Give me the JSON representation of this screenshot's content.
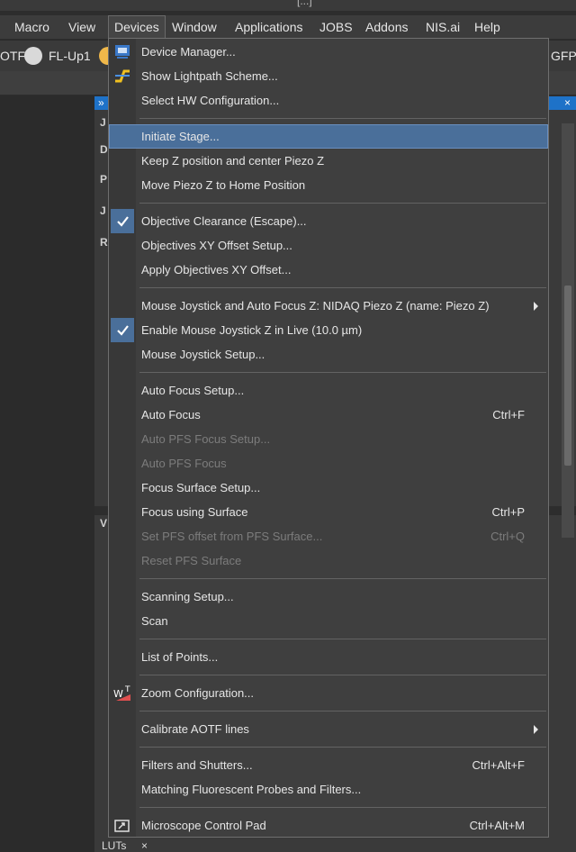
{
  "titlebar": {
    "fragment": "[...]"
  },
  "menubar": [
    {
      "label": "Macro",
      "active": false
    },
    {
      "label": "View",
      "active": false
    },
    {
      "label": "Devices",
      "active": true
    },
    {
      "label": "Window",
      "active": false
    },
    {
      "label": "Applications",
      "active": false
    },
    {
      "label": "JOBS",
      "active": false
    },
    {
      "label": "Addons",
      "active": false
    },
    {
      "label": "NIS.ai",
      "active": false
    },
    {
      "label": "Help",
      "active": false
    }
  ],
  "toolbar": {
    "left_label": "OTF",
    "fl_label": "FL-Up1",
    "right_label": "GFP"
  },
  "dock": {
    "header_arrows": "»",
    "close": "×",
    "letters": [
      "J",
      "D",
      "P",
      "J",
      "R",
      "V"
    ]
  },
  "bottom_tab": {
    "label": "LUTs",
    "close": "×"
  },
  "menu": {
    "groups": [
      [
        {
          "label": "Device Manager...",
          "icon": "device-manager-icon"
        },
        {
          "label": "Show Lightpath Scheme...",
          "icon": "lightpath-icon"
        },
        {
          "label": "Select HW Configuration..."
        }
      ],
      [
        {
          "label": "Initiate Stage...",
          "highlighted": true
        },
        {
          "label": "Keep Z position and center Piezo Z"
        },
        {
          "label": "Move Piezo Z to Home Position"
        }
      ],
      [
        {
          "label": "Objective Clearance (Escape)...",
          "checked": true
        },
        {
          "label": "Objectives XY Offset Setup..."
        },
        {
          "label": "Apply Objectives XY Offset..."
        }
      ],
      [
        {
          "label": "Mouse Joystick and Auto Focus Z: NIDAQ Piezo Z (name: Piezo Z)",
          "submenu": true
        },
        {
          "label": "Enable Mouse Joystick Z in Live (10.0 µm)",
          "checked": true
        },
        {
          "label": "Mouse Joystick Setup..."
        }
      ],
      [
        {
          "label": "Auto Focus Setup..."
        },
        {
          "label": "Auto Focus",
          "shortcut": "Ctrl+F"
        },
        {
          "label": "Auto PFS Focus Setup...",
          "disabled": true
        },
        {
          "label": "Auto PFS Focus",
          "disabled": true
        },
        {
          "label": "Focus Surface Setup..."
        },
        {
          "label": "Focus using Surface",
          "shortcut": "Ctrl+P"
        },
        {
          "label": "Set PFS offset from PFS Surface...",
          "shortcut": "Ctrl+Q",
          "disabled": true
        },
        {
          "label": "Reset PFS Surface",
          "disabled": true
        }
      ],
      [
        {
          "label": "Scanning Setup..."
        },
        {
          "label": "Scan"
        }
      ],
      [
        {
          "label": "List of Points..."
        }
      ],
      [
        {
          "label": "Zoom Configuration...",
          "icon": "zoom-config-icon"
        }
      ],
      [
        {
          "label": "Calibrate AOTF lines",
          "submenu": true
        }
      ],
      [
        {
          "label": "Filters and Shutters...",
          "shortcut": "Ctrl+Alt+F"
        },
        {
          "label": "Matching Fluorescent Probes and Filters..."
        }
      ],
      [
        {
          "label": "Microscope Control Pad",
          "shortcut": "Ctrl+Alt+M",
          "icon": "control-pad-icon"
        }
      ]
    ]
  }
}
